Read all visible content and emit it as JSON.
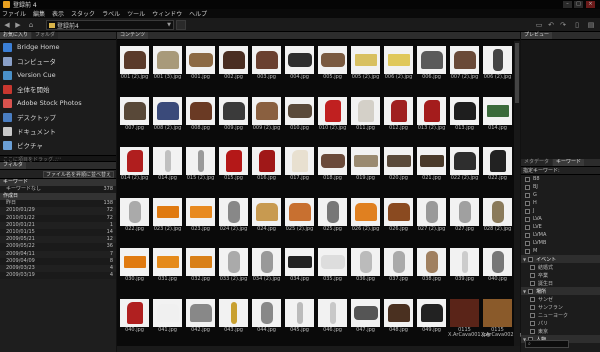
{
  "window": {
    "title": "登録前 4",
    "controls": [
      "–",
      "□",
      "×"
    ]
  },
  "menu": [
    "ファイル",
    "編集",
    "表示",
    "スタック",
    "ラベル",
    "ツール",
    "ウィンドウ",
    "ヘルプ"
  ],
  "toolbar": {
    "back_icon": "arrow-left-icon",
    "forward_icon": "arrow-right-icon",
    "path": "登録前4",
    "path_dropdown": "▼"
  },
  "left_panel": {
    "tabs": [
      "お気に入り",
      "フォルダ"
    ],
    "favorites": [
      {
        "label": "Bridge Home",
        "icon": "bridge-home-icon",
        "color": "#3b7fd6"
      },
      {
        "label": "コンピュータ",
        "icon": "computer-icon",
        "color": "#8aa0c8"
      },
      {
        "label": "Version Cue",
        "icon": "version-cue-icon",
        "color": "#4a90c8"
      },
      {
        "label": "全体を開始",
        "icon": "start-icon",
        "color": "#c8372f"
      },
      {
        "label": "Adobe Stock Photos",
        "icon": "stock-photos-icon",
        "color": "#d9534f"
      },
      {
        "label": "デスクトップ",
        "icon": "desktop-icon",
        "color": "#4a7ec2"
      },
      {
        "label": "ドキュメント",
        "icon": "documents-icon",
        "color": "#c9c9c9"
      },
      {
        "label": "ピクチャ",
        "icon": "pictures-icon",
        "color": "#6a9fd6"
      }
    ],
    "drag_hint": "ここに項目をドラッグ…",
    "filter_tab": "フィルタ",
    "filter_sort": "ファイル名を昇順に並べ替え",
    "filter_sections": [
      {
        "title": "キーワード",
        "rows": [
          {
            "label": "キーワードなし",
            "count": "378"
          }
        ]
      },
      {
        "title": "作成日",
        "rows": [
          {
            "label": "昨日",
            "count": "138"
          },
          {
            "label": "2010/01/29",
            "count": "72"
          },
          {
            "label": "2010/01/22",
            "count": "72"
          },
          {
            "label": "2010/01/21",
            "count": "1"
          },
          {
            "label": "2010/01/15",
            "count": "14"
          },
          {
            "label": "2009/05/21",
            "count": "12"
          },
          {
            "label": "2009/05/22",
            "count": "36"
          },
          {
            "label": "2009/04/11",
            "count": "7"
          },
          {
            "label": "2009/04/09",
            "count": "8"
          },
          {
            "label": "2009/03/23",
            "count": "4"
          },
          {
            "label": "2009/03/19",
            "count": "4"
          }
        ]
      }
    ]
  },
  "content": {
    "tab": "コンテンツ",
    "thumbnails": [
      {
        "label": "001 (2).jpg",
        "shape": "bag",
        "color": "#5a3a2a"
      },
      {
        "label": "001 (3).jpg",
        "shape": "bag",
        "color": "#a89a7a"
      },
      {
        "label": "001.jpg",
        "shape": "pouch",
        "color": "#8c6a44"
      },
      {
        "label": "002.jpg",
        "shape": "bag",
        "color": "#4a2e22"
      },
      {
        "label": "003.jpg",
        "shape": "bag",
        "color": "#6a4030"
      },
      {
        "label": "004.jpg",
        "shape": "pouch",
        "color": "#2e2e2e"
      },
      {
        "label": "005.jpg",
        "shape": "pouch",
        "color": "#7a5a40"
      },
      {
        "label": "005 (2).jpg",
        "shape": "card",
        "color": "#d8c060"
      },
      {
        "label": "006 (2).jpg",
        "shape": "card",
        "color": "#e0c85a"
      },
      {
        "label": "006.jpg",
        "shape": "bag",
        "color": "#5a5a5a"
      },
      {
        "label": "007 (2).jpg",
        "shape": "bag",
        "color": "#6a4a38"
      },
      {
        "label": "006 (2).jpg",
        "shape": "figure",
        "color": "#444"
      },
      {
        "label": "007.jpg",
        "shape": "bag",
        "color": "#584838"
      },
      {
        "label": "008 (2).jpg",
        "shape": "bag",
        "color": "#3a4a7a"
      },
      {
        "label": "008.jpg",
        "shape": "bag",
        "color": "#6a3a24"
      },
      {
        "label": "009.jpg",
        "shape": "bag",
        "color": "#3a3a3a"
      },
      {
        "label": "009 (2).jpg",
        "shape": "bag",
        "color": "#8a6040"
      },
      {
        "label": "010.jpg",
        "shape": "pouch",
        "color": "#5a4a3a"
      },
      {
        "label": "010 (2).jpg",
        "shape": "shoe",
        "color": "#c02020"
      },
      {
        "label": "011.jpg",
        "shape": "shoe",
        "color": "#d4d0c8"
      },
      {
        "label": "012.jpg",
        "shape": "shoe",
        "color": "#a02020"
      },
      {
        "label": "013 (2).jpg",
        "shape": "shoe",
        "color": "#a41c1c"
      },
      {
        "label": "013.jpg",
        "shape": "bag",
        "color": "#1e1e1e"
      },
      {
        "label": "014.jpg",
        "shape": "card",
        "color": "#3a6a3a"
      },
      {
        "label": "014 (2).jpg",
        "shape": "shoe",
        "color": "#b01e1e"
      },
      {
        "label": "014.jpg",
        "shape": "jewel",
        "color": "#c0c0c0"
      },
      {
        "label": "015 (2).jpg",
        "shape": "jewel",
        "color": "#9a9a9a"
      },
      {
        "label": "015.jpg",
        "shape": "shoe",
        "color": "#b41818"
      },
      {
        "label": "016.jpg",
        "shape": "shoe",
        "color": "#a01818"
      },
      {
        "label": "017.jpg",
        "shape": "shoe",
        "color": "#e8e0d0"
      },
      {
        "label": "018.jpg",
        "shape": "pouch",
        "color": "#6a4a3a"
      },
      {
        "label": "019.jpg",
        "shape": "wallet",
        "color": "#9a8a70"
      },
      {
        "label": "020.jpg",
        "shape": "wallet",
        "color": "#5a4a3a"
      },
      {
        "label": "021.jpg",
        "shape": "wallet",
        "color": "#4a3a2a"
      },
      {
        "label": "022 (2).jpg",
        "shape": "bag",
        "color": "#2e2e2e"
      },
      {
        "label": "022.jpg",
        "shape": "shoe",
        "color": "#222"
      },
      {
        "label": "022.jpg",
        "shape": "watch",
        "color": "#aaa"
      },
      {
        "label": "023 (2).jpg",
        "shape": "card",
        "color": "#e07a10"
      },
      {
        "label": "023.jpg",
        "shape": "card",
        "color": "#e88a20"
      },
      {
        "label": "024 (2).jpg",
        "shape": "watch",
        "color": "#888"
      },
      {
        "label": "024.jpg",
        "shape": "bag",
        "color": "#c89a50"
      },
      {
        "label": "025 (2).jpg",
        "shape": "bag",
        "color": "#c87030"
      },
      {
        "label": "025.jpg",
        "shape": "watch",
        "color": "#777"
      },
      {
        "label": "026 (2).jpg",
        "shape": "bag",
        "color": "#e08020"
      },
      {
        "label": "026.jpg",
        "shape": "bag",
        "color": "#8a4a20"
      },
      {
        "label": "027 (2).jpg",
        "shape": "watch",
        "color": "#999"
      },
      {
        "label": "027.jpg",
        "shape": "watch",
        "color": "#a0a0a0"
      },
      {
        "label": "028 (2).jpg",
        "shape": "watch",
        "color": "#8a7a5a"
      },
      {
        "label": "030.jpg",
        "shape": "card",
        "color": "#e07a10"
      },
      {
        "label": "031.jpg",
        "shape": "card",
        "color": "#e58a1a"
      },
      {
        "label": "032.jpg",
        "shape": "card",
        "color": "#d98018"
      },
      {
        "label": "033 (2).jpg",
        "shape": "watch",
        "color": "#aaa"
      },
      {
        "label": "034 (2).jpg",
        "shape": "watch",
        "color": "#999"
      },
      {
        "label": "034.jpg",
        "shape": "wallet",
        "color": "#222"
      },
      {
        "label": "035.jpg",
        "shape": "pouch",
        "color": "#ddd"
      },
      {
        "label": "036.jpg",
        "shape": "watch",
        "color": "#bbb"
      },
      {
        "label": "037.jpg",
        "shape": "watch",
        "color": "#aaa"
      },
      {
        "label": "038.jpg",
        "shape": "watch",
        "color": "#a08060"
      },
      {
        "label": "039.jpg",
        "shape": "jewel",
        "color": "#ccc"
      },
      {
        "label": "040.jpg",
        "shape": "watch",
        "color": "#777"
      },
      {
        "label": "040.jpg",
        "shape": "shoe",
        "color": "#b02020"
      },
      {
        "label": "041.jpg",
        "shape": "bag",
        "color": "#f0f0f0"
      },
      {
        "label": "042.jpg",
        "shape": "bag",
        "color": "#888"
      },
      {
        "label": "043.jpg",
        "shape": "jewel",
        "color": "#c8a030"
      },
      {
        "label": "044.jpg",
        "shape": "watch",
        "color": "#888"
      },
      {
        "label": "045.jpg",
        "shape": "jewel",
        "color": "#bbb"
      },
      {
        "label": "046.jpg",
        "shape": "jewel",
        "color": "#c8c8c8"
      },
      {
        "label": "047.jpg",
        "shape": "pouch",
        "color": "#555"
      },
      {
        "label": "048.jpg",
        "shape": "bag",
        "color": "#4a3020"
      },
      {
        "label": "049.jpg",
        "shape": "bag",
        "color": "#222"
      },
      {
        "label": "0115 X.ArCava001.jpg",
        "shape": "photo",
        "color": "#5a2418"
      },
      {
        "label": "0115 X.ArCava002.jpg",
        "shape": "photo",
        "color": "#8a5a2a"
      }
    ]
  },
  "right_panel": {
    "tab": "プレビュー",
    "meta_tabs": [
      "メタデータ",
      "キーワード"
    ],
    "meta_head": "指定キーワード:",
    "keywords": [
      {
        "type": "kw",
        "label": "B8"
      },
      {
        "type": "kw",
        "label": "BJ"
      },
      {
        "type": "kw",
        "label": "G"
      },
      {
        "type": "kw",
        "label": "H"
      },
      {
        "type": "kw",
        "label": "J"
      },
      {
        "type": "kw",
        "label": "LVA"
      },
      {
        "type": "kw",
        "label": "LVE"
      },
      {
        "type": "kw",
        "label": "LVMA"
      },
      {
        "type": "kw",
        "label": "LVMB"
      },
      {
        "type": "kw",
        "label": "M"
      },
      {
        "type": "cat",
        "label": "イベント"
      },
      {
        "type": "sub",
        "label": "結婚式"
      },
      {
        "type": "sub",
        "label": "卒業"
      },
      {
        "type": "sub",
        "label": "誕生日"
      },
      {
        "type": "cat",
        "label": "場所"
      },
      {
        "type": "sub",
        "label": "サンゼ"
      },
      {
        "type": "sub",
        "label": "サンフラン"
      },
      {
        "type": "sub",
        "label": "ニューヨーク"
      },
      {
        "type": "sub",
        "label": "パリ"
      },
      {
        "type": "sub",
        "label": "東京"
      },
      {
        "type": "cat",
        "label": "人物"
      }
    ],
    "search_icon": "search-icon"
  }
}
